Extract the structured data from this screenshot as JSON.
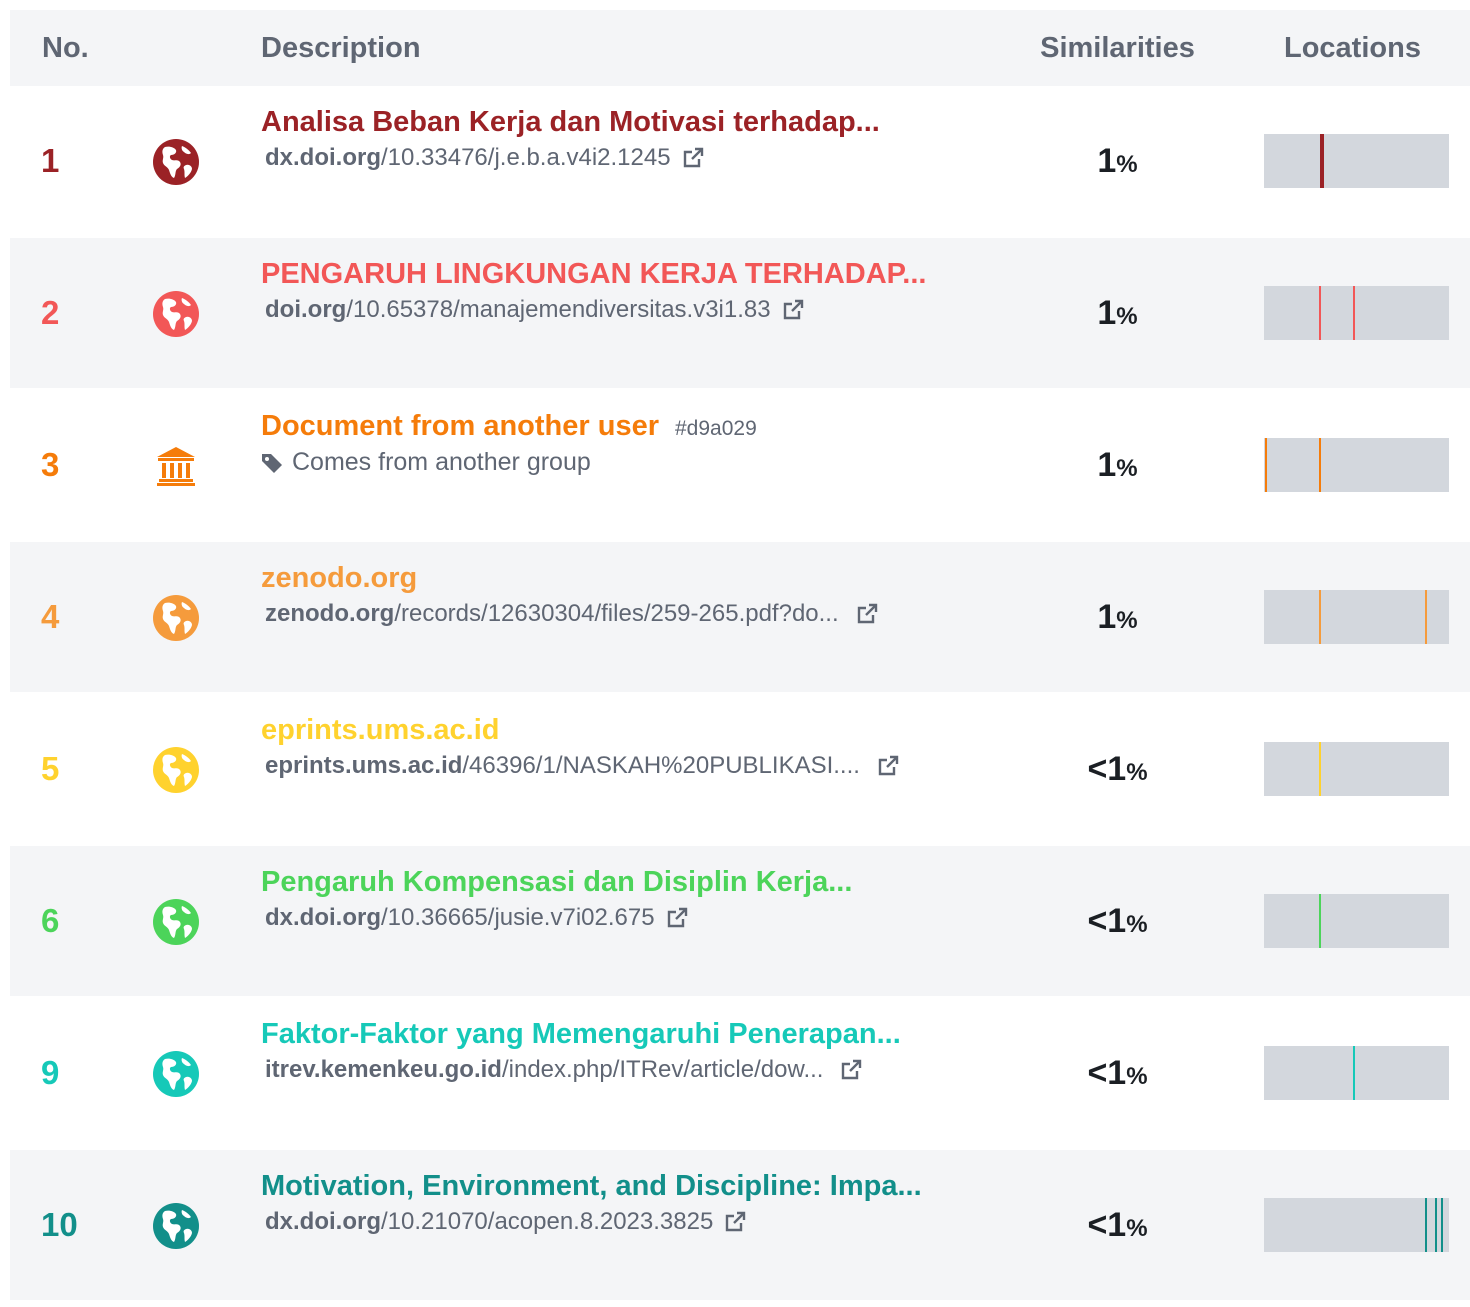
{
  "headers": {
    "no": "No.",
    "description": "Description",
    "similarities": "Similarities",
    "locations": "Locations"
  },
  "rows": [
    {
      "no": "1",
      "color": "#9b2226",
      "icon": "globe-icon",
      "title": "Analisa Beban Kerja dan Motivasi terhadap...",
      "url_domain": "dx.doi.org",
      "url_path": "/10.33476/j.e.b.a.v4i2.1245",
      "pct_prefix": "",
      "pct_value": "1",
      "pct_unit": "%",
      "locations": [
        0.3,
        0.31
      ]
    },
    {
      "no": "2",
      "color": "#f25757",
      "icon": "globe-icon",
      "title": "PENGARUH LINGKUNGAN KERJA TERHADAP...",
      "url_domain": "doi.org",
      "url_path": "/10.65378/manajemendiversitas.v3i1.83",
      "pct_prefix": "",
      "pct_value": "1",
      "pct_unit": "%",
      "locations": [
        0.295,
        0.48
      ]
    },
    {
      "no": "3",
      "color": "#f57c0a",
      "icon": "institution-icon",
      "title": "Document from another user",
      "tag": "#d9a029",
      "group_text": "Comes from another group",
      "pct_prefix": "",
      "pct_value": "1",
      "pct_unit": "%",
      "locations": [
        0.005,
        0.295
      ]
    },
    {
      "no": "4",
      "color": "#f59b3c",
      "icon": "globe-icon",
      "title": "zenodo.org",
      "url_domain": "zenodo.org",
      "url_path": "/records/12630304/files/259-265.pdf?do...",
      "pct_prefix": "",
      "pct_value": "1",
      "pct_unit": "%",
      "locations": [
        0.295,
        0.87
      ]
    },
    {
      "no": "5",
      "color": "#ffd22e",
      "icon": "globe-icon",
      "title": "eprints.ums.ac.id",
      "url_domain": "eprints.ums.ac.id",
      "url_path": "/46396/1/NASKAH%20PUBLIKASI....",
      "pct_prefix": "<",
      "pct_value": "1",
      "pct_unit": "%",
      "locations": [
        0.295
      ]
    },
    {
      "no": "6",
      "color": "#4cd45a",
      "icon": "globe-icon",
      "title": "Pengaruh Kompensasi dan Disiplin Kerja...",
      "url_domain": "dx.doi.org",
      "url_path": "/10.36665/jusie.v7i02.675",
      "pct_prefix": "<",
      "pct_value": "1",
      "pct_unit": "%",
      "locations": [
        0.295
      ]
    },
    {
      "no": "9",
      "color": "#16c9b8",
      "icon": "globe-icon",
      "title": "Faktor-Faktor yang Memengaruhi Penerapan...",
      "url_domain": "itrev.kemenkeu.go.id",
      "url_path": "/index.php/ITRev/article/dow...",
      "pct_prefix": "<",
      "pct_value": "1",
      "pct_unit": "%",
      "locations": [
        0.48
      ]
    },
    {
      "no": "10",
      "color": "#128f8a",
      "icon": "globe-icon",
      "title": "Motivation, Environment, and Discipline: Impa...",
      "url_domain": "dx.doi.org",
      "url_path": "/10.21070/acopen.8.2023.3825",
      "pct_prefix": "<",
      "pct_value": "1",
      "pct_unit": "%",
      "locations": [
        0.87,
        0.925,
        0.955
      ]
    }
  ]
}
